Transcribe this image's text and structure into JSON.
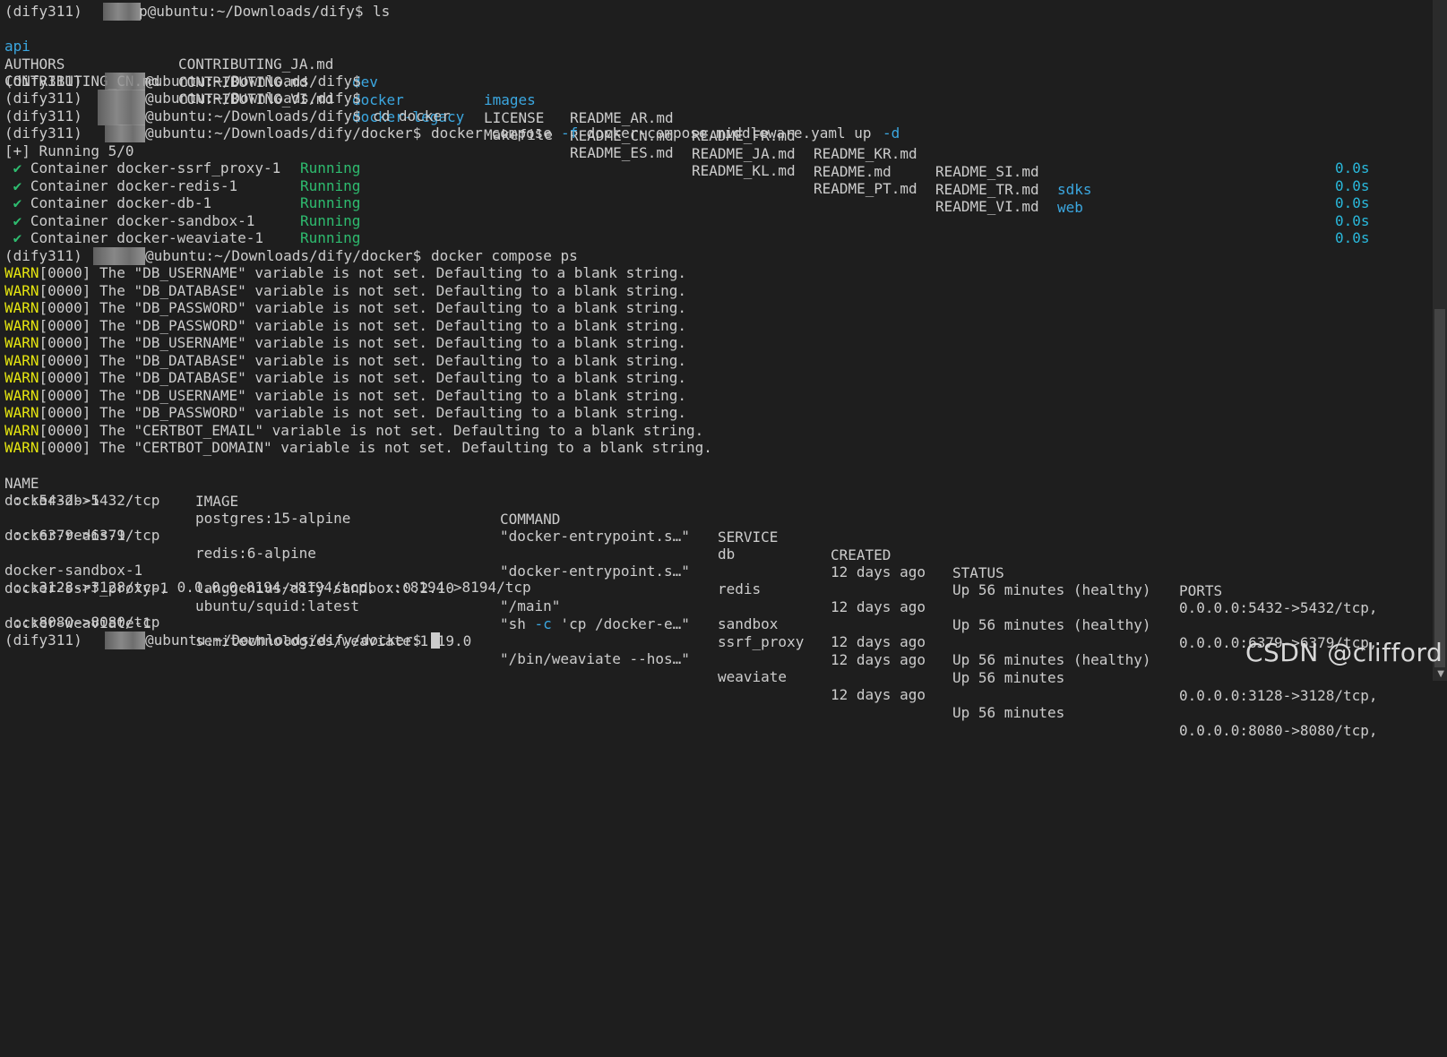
{
  "colors": {
    "background": "#1e1e1e",
    "text": "#cccccc",
    "directory_blue": "#3ba7e0",
    "running_green": "#2ebc6f",
    "timing_teal": "#29b8db",
    "warn_yellow": "#e5e510"
  },
  "prompts": {
    "first": "(dify311) ",
    "first_rest": "p@ubuntu:~/Downloads/dify$ ",
    "cmd_ls": "ls",
    "p2_rest": "@ubuntu:~/Downloads/dify$",
    "p3_rest": "@ubuntu:~/Downloads/dify$",
    "p4_rest": "@ubuntu:~/Downloads/dify$ ",
    "cmd_cd": "cd docker",
    "p5_rest": "@ubuntu:~/Downloads/dify/docker$ ",
    "cmd_compose_a": "docker compose ",
    "flag_f": "-f",
    "cmd_compose_b": " docker-compose.middleware.yaml up ",
    "flag_d": "-d",
    "p6_rest": "@ubuntu:~/Downloads/dify/docker$ ",
    "cmd_ps": "docker compose ps",
    "p7_rest": "@ubuntu:~/Downloads/dify/docker$ ",
    "env": "(dify311) "
  },
  "ls_output": {
    "row1": [
      "api",
      "CONTRIBUTING_JA.md",
      "dev",
      "images",
      "README_AR.md",
      "README_FR.md",
      "README_KR.md",
      "README_SI.md",
      "sdks"
    ],
    "row2": [
      "AUTHORS",
      "CONTRIBUTING.md",
      "docker",
      "LICENSE",
      "README_CN.md",
      "README_JA.md",
      "README.md",
      "README_TR.md",
      "web"
    ],
    "row3": [
      "CONTRIBUTING_CN.md",
      "CONTRIBUTING_VI.md",
      "docker-legacy",
      "Makefile",
      "README_ES.md",
      "README_KL.md",
      "README_PT.md",
      "README_VI.md"
    ]
  },
  "running_header": "[+] Running 5/0",
  "containers": [
    {
      "check": " ✔",
      "name": " Container docker-ssrf_proxy-1",
      "status": "Running",
      "time": "0.0s"
    },
    {
      "check": " ✔",
      "name": " Container docker-redis-1",
      "status": "Running",
      "time": "0.0s"
    },
    {
      "check": " ✔",
      "name": " Container docker-db-1",
      "status": "Running",
      "time": "0.0s"
    },
    {
      "check": " ✔",
      "name": " Container docker-sandbox-1",
      "status": "Running",
      "time": "0.0s"
    },
    {
      "check": " ✔",
      "name": " Container docker-weaviate-1",
      "status": "Running",
      "time": "0.0s"
    }
  ],
  "warnings": [
    {
      "tag": "WARN",
      "text": "[0000] The \"DB_USERNAME\" variable is not set. Defaulting to a blank string."
    },
    {
      "tag": "WARN",
      "text": "[0000] The \"DB_DATABASE\" variable is not set. Defaulting to a blank string."
    },
    {
      "tag": "WARN",
      "text": "[0000] The \"DB_PASSWORD\" variable is not set. Defaulting to a blank string."
    },
    {
      "tag": "WARN",
      "text": "[0000] The \"DB_PASSWORD\" variable is not set. Defaulting to a blank string."
    },
    {
      "tag": "WARN",
      "text": "[0000] The \"DB_USERNAME\" variable is not set. Defaulting to a blank string."
    },
    {
      "tag": "WARN",
      "text": "[0000] The \"DB_DATABASE\" variable is not set. Defaulting to a blank string."
    },
    {
      "tag": "WARN",
      "text": "[0000] The \"DB_DATABASE\" variable is not set. Defaulting to a blank string."
    },
    {
      "tag": "WARN",
      "text": "[0000] The \"DB_USERNAME\" variable is not set. Defaulting to a blank string."
    },
    {
      "tag": "WARN",
      "text": "[0000] The \"DB_PASSWORD\" variable is not set. Defaulting to a blank string."
    },
    {
      "tag": "WARN",
      "text": "[0000] The \"CERTBOT_EMAIL\" variable is not set. Defaulting to a blank string."
    },
    {
      "tag": "WARN",
      "text": "[0000] The \"CERTBOT_DOMAIN\" variable is not set. Defaulting to a blank string."
    }
  ],
  "ps_table": {
    "headers": [
      "NAME",
      "IMAGE",
      "COMMAND",
      "SERVICE",
      "CREATED",
      "STATUS",
      "PORTS"
    ],
    "rows": [
      {
        "name": "docker-db-1",
        "image": "postgres:15-alpine",
        "command": "\"docker-entrypoint.s…\"",
        "service": "db",
        "created": "12 days ago",
        "status": "Up 56 minutes (healthy)",
        "ports": "0.0.0.0:5432->5432/tcp,",
        "ports_cont": " :::5432->5432/tcp"
      },
      {
        "name": "docker-redis-1",
        "image": "redis:6-alpine",
        "command": "\"docker-entrypoint.s…\"",
        "service": "redis",
        "created": "12 days ago",
        "status": "Up 56 minutes (healthy)",
        "ports": "0.0.0.0:6379->6379/tcp,",
        "ports_cont": " :::6379->6379/tcp"
      },
      {
        "name": "docker-sandbox-1",
        "image": "langgenius/dify-sandbox:0.2.10",
        "command": "\"/main\"",
        "service": "sandbox",
        "created": "12 days ago",
        "status": "Up 56 minutes (healthy)",
        "ports": "",
        "ports_cont": ""
      },
      {
        "name": "docker-ssrf_proxy-1",
        "image": "ubuntu/squid:latest",
        "command_a": "\"sh ",
        "command_flag": "-c",
        "command_b": " 'cp /docker-e…\"",
        "service": "ssrf_proxy",
        "created": "12 days ago",
        "status": "Up 56 minutes",
        "ports": "0.0.0.0:3128->3128/tcp,",
        "ports_cont": " :::3128->3128/tcp, 0.0.0.0:8194->8194/tcp, :::8194->8194/tcp"
      },
      {
        "name": "docker-weaviate-1",
        "image": "semitechnologies/weaviate:1.19.0",
        "command": "\"/bin/weaviate --hos…\"",
        "service": "weaviate",
        "created": "12 days ago",
        "status": "Up 56 minutes",
        "ports": "0.0.0.0:8080->8080/tcp,",
        "ports_cont": " :::8080->8080/tcp"
      }
    ]
  },
  "watermark": "CSDN @clifford"
}
